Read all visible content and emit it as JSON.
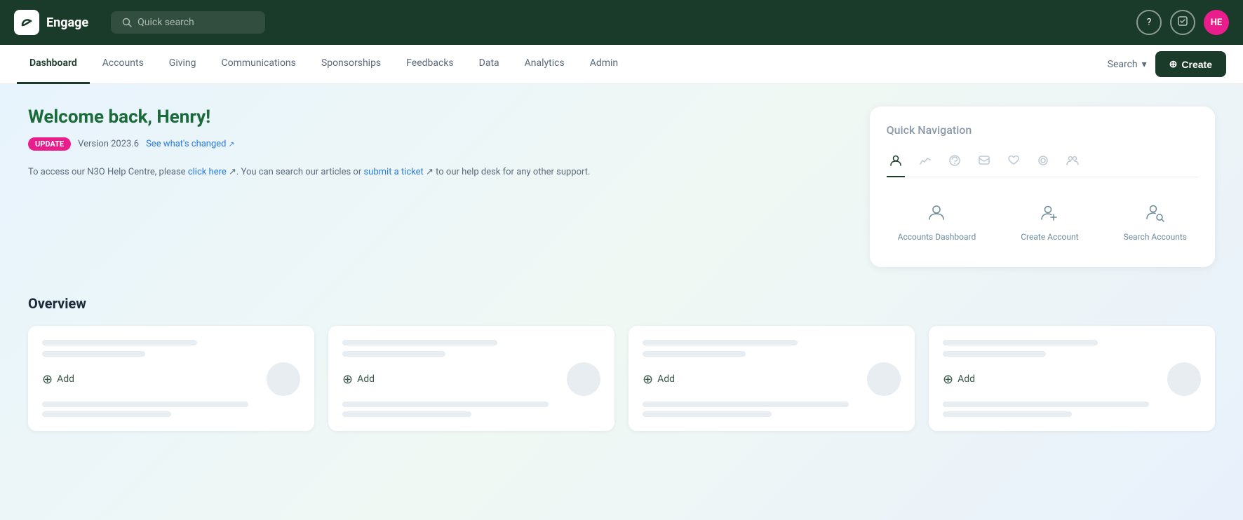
{
  "topnav": {
    "logo_label": "Engage",
    "search_placeholder": "Quick search",
    "help_icon": "?",
    "check_icon": "✓",
    "avatar_initials": "HE"
  },
  "secnav": {
    "items": [
      {
        "label": "Dashboard",
        "active": true
      },
      {
        "label": "Accounts",
        "active": false
      },
      {
        "label": "Giving",
        "active": false
      },
      {
        "label": "Communications",
        "active": false
      },
      {
        "label": "Sponsorships",
        "active": false
      },
      {
        "label": "Feedbacks",
        "active": false
      },
      {
        "label": "Data",
        "active": false
      },
      {
        "label": "Analytics",
        "active": false
      },
      {
        "label": "Admin",
        "active": false
      }
    ],
    "search_label": "Search",
    "create_label": "Create"
  },
  "welcome": {
    "greeting": "Welcome back, ",
    "name": "Henry!",
    "update_badge": "UPDATE",
    "version": "Version 2023.6",
    "whats_changed": "See what's changed",
    "help_text1": "To access our N3O Help Centre, please ",
    "click_here": "click here",
    "help_text2": ". You can search our articles or ",
    "submit_ticket": "submit a ticket",
    "help_text3": " to our help desk for any other support."
  },
  "quick_nav": {
    "title": "Quick Navigation",
    "tabs": [
      {
        "icon": "👤",
        "active": true
      },
      {
        "icon": "📊",
        "active": false
      },
      {
        "icon": "🎧",
        "active": false
      },
      {
        "icon": "💬",
        "active": false
      },
      {
        "icon": "♥",
        "active": false
      },
      {
        "icon": "◎",
        "active": false
      },
      {
        "icon": "👥",
        "active": false
      }
    ],
    "items": [
      {
        "label": "Accounts Dashboard",
        "icon": "person"
      },
      {
        "label": "Create Account",
        "icon": "person-add"
      },
      {
        "label": "Search Accounts",
        "icon": "person-search"
      }
    ]
  },
  "overview": {
    "title": "Overview",
    "cards": [
      {
        "add_label": "Add"
      },
      {
        "add_label": "Add"
      },
      {
        "add_label": "Add"
      },
      {
        "add_label": "Add"
      }
    ]
  }
}
